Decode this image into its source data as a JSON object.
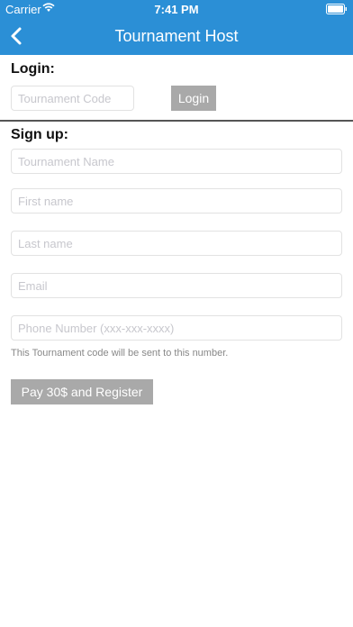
{
  "status_bar": {
    "carrier": "Carrier",
    "time": "7:41 PM",
    "wifi_icon": "wifi-icon",
    "battery_icon": "battery-icon"
  },
  "nav": {
    "title": "Tournament Host",
    "back_icon": "chevron-left-icon",
    "background_color": "#2b8fd6"
  },
  "login": {
    "label": "Login:",
    "code_placeholder": "Tournament Code",
    "code_value": "",
    "button_label": "Login"
  },
  "signup": {
    "label": "Sign up:",
    "fields": {
      "tournament_name": {
        "placeholder": "Tournament Name",
        "value": ""
      },
      "first_name": {
        "placeholder": "First name",
        "value": ""
      },
      "last_name": {
        "placeholder": "Last name",
        "value": ""
      },
      "email": {
        "placeholder": "Email",
        "value": ""
      },
      "phone": {
        "placeholder": "Phone Number (xxx-xxx-xxxx)",
        "value": ""
      }
    },
    "hint": "This Tournament code will be sent to this number.",
    "button_label": "Pay 30$ and Register"
  }
}
